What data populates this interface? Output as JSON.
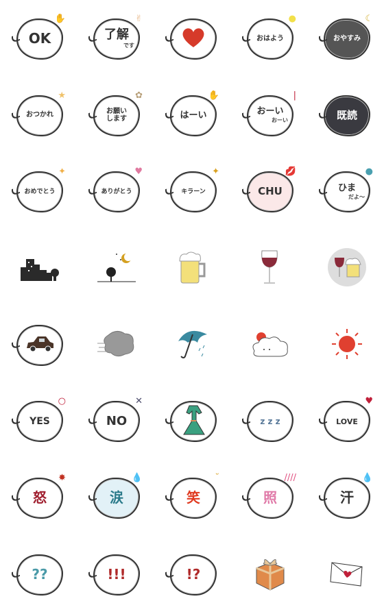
{
  "stickers": [
    {
      "text": "OK",
      "color": "#333333",
      "size": 20,
      "deco": "✋",
      "decoColor": "#e8b98a"
    },
    {
      "text": "了解",
      "sub": "です",
      "color": "#333333",
      "size": 18,
      "deco": "✌",
      "decoColor": "#e8b98a"
    },
    {
      "icon": "heart",
      "color": "#d63a2a"
    },
    {
      "text": "おはよう",
      "color": "#333333",
      "size": 10,
      "deco": "●",
      "decoColor": "#f2e04a"
    },
    {
      "text": "おやすみ",
      "color": "#ffffff",
      "bg": "#555555",
      "size": 10,
      "deco": "☾",
      "decoColor": "#d4b23a"
    },
    {
      "text": "おつかれ",
      "color": "#333333",
      "size": 10,
      "deco": "★",
      "decoColor": "#f0c26a"
    },
    {
      "text": "お願い\nします",
      "color": "#333333",
      "size": 10,
      "deco": "✿",
      "decoColor": "#b8a07a"
    },
    {
      "text": "はーい",
      "color": "#333333",
      "size": 13,
      "deco": "✋",
      "decoColor": "#e8b98a"
    },
    {
      "text": "おーい",
      "sub": "おーい",
      "color": "#333333",
      "size": 13,
      "deco": "|",
      "decoColor": "#c0203a"
    },
    {
      "text": "既読",
      "color": "#ffffff",
      "bg": "#3a3a40",
      "size": 15
    },
    {
      "text": "おめでとう",
      "color": "#333333",
      "size": 9,
      "deco": "✦",
      "decoColor": "#f0b04a"
    },
    {
      "text": "ありがとう",
      "color": "#333333",
      "size": 9,
      "deco": "♥",
      "decoColor": "#e07aa0"
    },
    {
      "text": "キラーン",
      "color": "#333333",
      "size": 9,
      "deco": "✦",
      "decoColor": "#d9a020"
    },
    {
      "text": "CHU",
      "color": "#333333",
      "bg": "#fbe8e8",
      "size": 15,
      "deco": "💋",
      "decoColor": "#c0203a"
    },
    {
      "text": "ひま",
      "sub": "だよ〜",
      "color": "#333333",
      "size": 13,
      "deco": "●",
      "decoColor": "#4aa0b0"
    },
    {
      "icon": "skyline",
      "noBubble": true
    },
    {
      "icon": "tree-moon",
      "noBubble": true
    },
    {
      "icon": "beer",
      "noBubble": true
    },
    {
      "icon": "wine",
      "noBubble": true
    },
    {
      "icon": "wine-beer",
      "noBubble": true
    },
    {
      "icon": "car"
    },
    {
      "icon": "wind",
      "noBubble": true
    },
    {
      "icon": "umbrella",
      "noBubble": true
    },
    {
      "icon": "cloud-sun",
      "noBubble": true
    },
    {
      "icon": "sun",
      "noBubble": true
    },
    {
      "text": "YES",
      "color": "#333333",
      "size": 14,
      "deco": "○",
      "decoColor": "#c0203a"
    },
    {
      "text": "NO",
      "color": "#333333",
      "size": 18,
      "deco": "✕",
      "decoColor": "#4a4a6a"
    },
    {
      "icon": "dress"
    },
    {
      "text": "z z z",
      "color": "#5a7a9a",
      "size": 12
    },
    {
      "text": "LOVE",
      "color": "#333333",
      "size": 11,
      "deco": "♥",
      "decoColor": "#c0203a"
    },
    {
      "text": "怒",
      "color": "#a02030",
      "size": 20,
      "deco": "✸",
      "decoColor": "#c03020"
    },
    {
      "text": "涙",
      "color": "#2a7a8a",
      "bg": "#e2f1f7",
      "size": 20,
      "deco": "💧",
      "decoColor": "#7ab0c0"
    },
    {
      "text": "笑",
      "color": "#e03a20",
      "size": 20,
      "deco": "˘",
      "decoColor": "#d9a020"
    },
    {
      "text": "照",
      "color": "#e07aa8",
      "size": 20,
      "deco": "////",
      "decoColor": "#e05080"
    },
    {
      "text": "汗",
      "color": "#333333",
      "size": 20,
      "deco": "💧",
      "decoColor": "#7ab0c0"
    },
    {
      "text": "??",
      "color": "#4a9aa8",
      "size": 20
    },
    {
      "text": "!!!",
      "color": "#b02a2a",
      "size": 20
    },
    {
      "text": "!?",
      "color": "#b02a2a",
      "size": 20
    },
    {
      "icon": "gift",
      "noBubble": true
    },
    {
      "icon": "envelope",
      "noBubble": true
    }
  ]
}
